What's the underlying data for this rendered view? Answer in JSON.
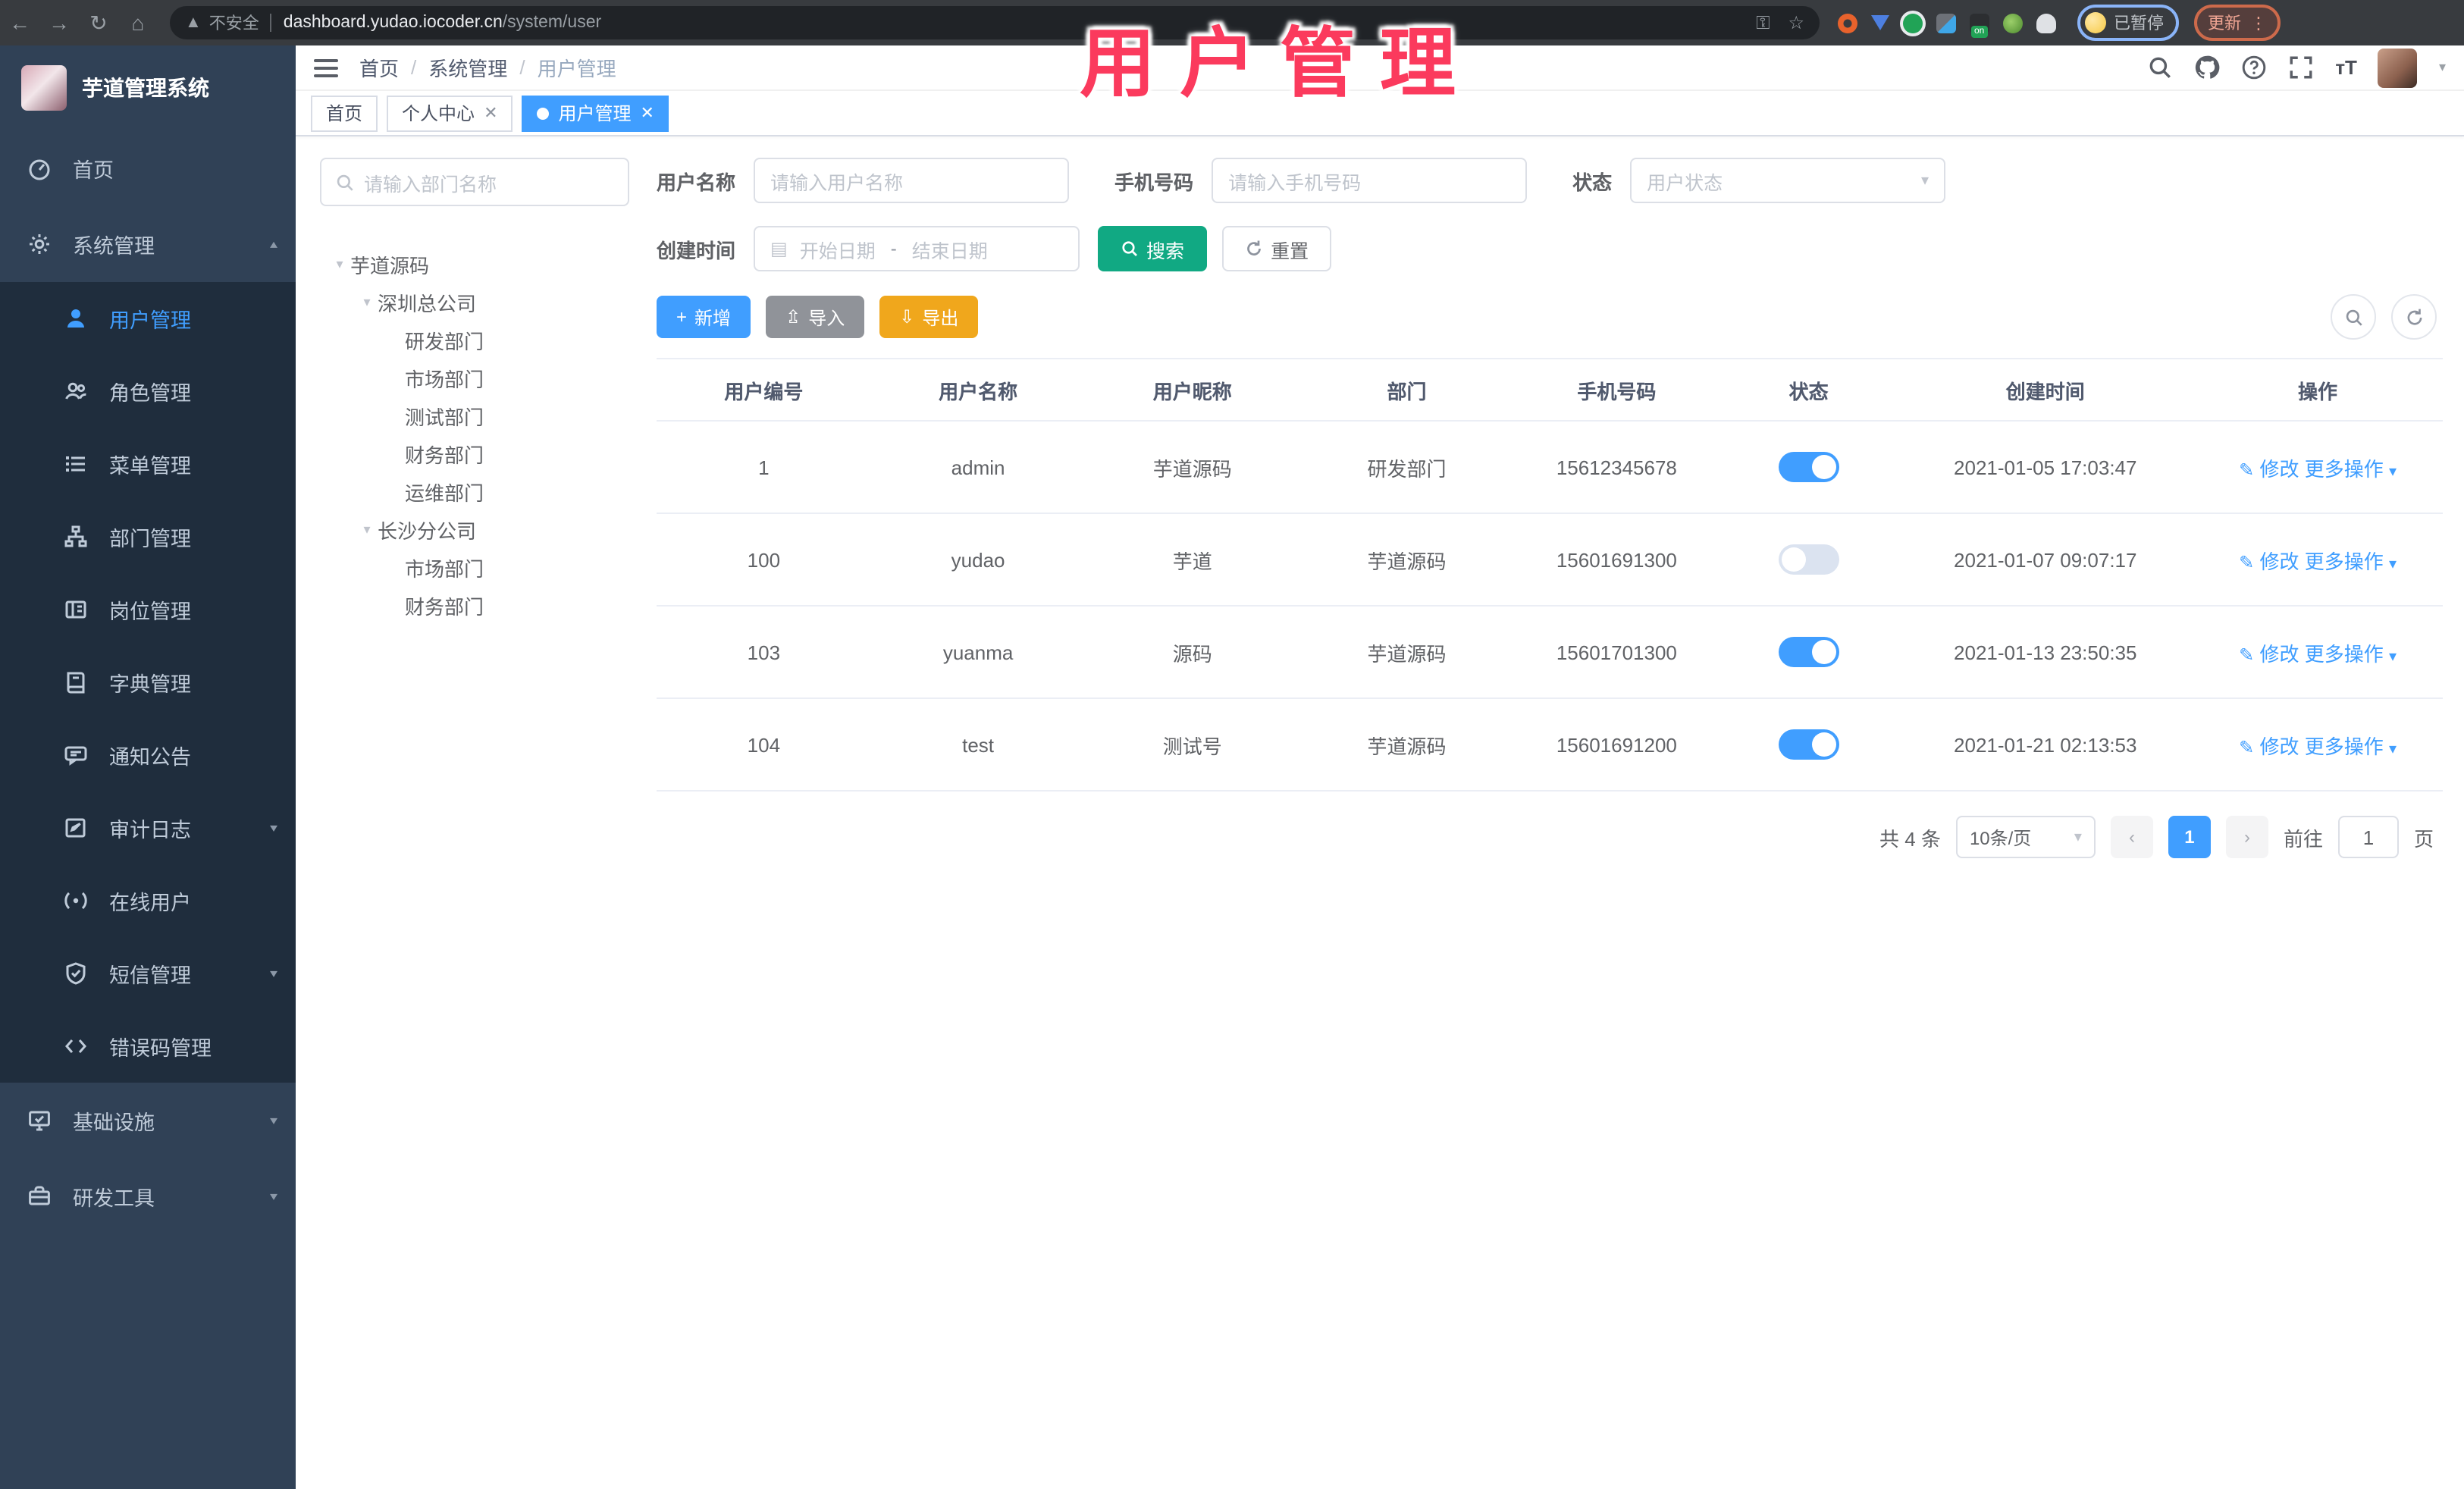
{
  "browser": {
    "security_label": "不安全",
    "url_host": "dashboard.yudao.iocoder.cn",
    "url_path": "/system/user",
    "extension_badge": "on",
    "profile_status": "已暂停",
    "update_label": "更新"
  },
  "overlay_title": "用户管理",
  "app_header": {
    "logo_title": "芋道管理系统",
    "breadcrumb": [
      "首页",
      "系统管理",
      "用户管理"
    ]
  },
  "tabs": [
    {
      "label": "首页",
      "closable": false,
      "active": false
    },
    {
      "label": "个人中心",
      "closable": true,
      "active": false
    },
    {
      "label": "用户管理",
      "closable": true,
      "active": true
    }
  ],
  "sidebar": {
    "items": [
      {
        "label": "首页",
        "icon": "dashboard-icon",
        "level": 1
      },
      {
        "label": "系统管理",
        "icon": "gear-icon",
        "level": 1,
        "chevron": "up"
      },
      {
        "label": "用户管理",
        "icon": "user-icon",
        "level": 2,
        "active": true
      },
      {
        "label": "角色管理",
        "icon": "roles-icon",
        "level": 2
      },
      {
        "label": "菜单管理",
        "icon": "menu-list-icon",
        "level": 2
      },
      {
        "label": "部门管理",
        "icon": "org-tree-icon",
        "level": 2
      },
      {
        "label": "岗位管理",
        "icon": "post-icon",
        "level": 2
      },
      {
        "label": "字典管理",
        "icon": "dict-icon",
        "level": 2
      },
      {
        "label": "通知公告",
        "icon": "notice-icon",
        "level": 2
      },
      {
        "label": "审计日志",
        "icon": "audit-icon",
        "level": 2,
        "chevron": "down"
      },
      {
        "label": "在线用户",
        "icon": "online-icon",
        "level": 2
      },
      {
        "label": "短信管理",
        "icon": "sms-icon",
        "level": 2,
        "chevron": "down"
      },
      {
        "label": "错误码管理",
        "icon": "errcode-icon",
        "level": 2
      },
      {
        "label": "基础设施",
        "icon": "infra-icon",
        "level": 1,
        "chevron": "down"
      },
      {
        "label": "研发工具",
        "icon": "devtools-icon",
        "level": 1,
        "chevron": "down"
      }
    ]
  },
  "dept_panel": {
    "search_placeholder": "请输入部门名称",
    "tree": [
      {
        "label": "芋道源码",
        "expanded": true,
        "children": [
          {
            "label": "深圳总公司",
            "expanded": true,
            "children": [
              {
                "label": "研发部门"
              },
              {
                "label": "市场部门"
              },
              {
                "label": "测试部门"
              },
              {
                "label": "财务部门"
              },
              {
                "label": "运维部门"
              }
            ]
          },
          {
            "label": "长沙分公司",
            "expanded": true,
            "children": [
              {
                "label": "市场部门"
              },
              {
                "label": "财务部门"
              }
            ]
          }
        ]
      }
    ]
  },
  "filters": {
    "username_label": "用户名称",
    "username_placeholder": "请输入用户名称",
    "mobile_label": "手机号码",
    "mobile_placeholder": "请输入手机号码",
    "status_label": "状态",
    "status_placeholder": "用户状态",
    "created_label": "创建时间",
    "date_start_placeholder": "开始日期",
    "date_separator": "-",
    "date_end_placeholder": "结束日期",
    "search_label": "搜索",
    "reset_label": "重置"
  },
  "toolbar": {
    "add_label": "新增",
    "import_label": "导入",
    "export_label": "导出"
  },
  "table": {
    "headers": [
      "用户编号",
      "用户名称",
      "用户昵称",
      "部门",
      "手机号码",
      "状态",
      "创建时间",
      "操作"
    ],
    "edit_label": "修改",
    "more_label": "更多操作",
    "rows": [
      {
        "id": "1",
        "username": "admin",
        "nickname": "芋道源码",
        "dept": "研发部门",
        "mobile": "15612345678",
        "status": true,
        "created": "2021-01-05 17:03:47"
      },
      {
        "id": "100",
        "username": "yudao",
        "nickname": "芋道",
        "dept": "芋道源码",
        "mobile": "15601691300",
        "status": false,
        "created": "2021-01-07 09:07:17"
      },
      {
        "id": "103",
        "username": "yuanma",
        "nickname": "源码",
        "dept": "芋道源码",
        "mobile": "15601701300",
        "status": true,
        "created": "2021-01-13 23:50:35"
      },
      {
        "id": "104",
        "username": "test",
        "nickname": "测试号",
        "dept": "芋道源码",
        "mobile": "15601691200",
        "status": true,
        "created": "2021-01-21 02:13:53"
      }
    ]
  },
  "pagination": {
    "total_text": "共 4 条",
    "page_size_text": "10条/页",
    "current_page": "1",
    "goto_label": "前往",
    "goto_value": "1",
    "page_unit": "页"
  }
}
